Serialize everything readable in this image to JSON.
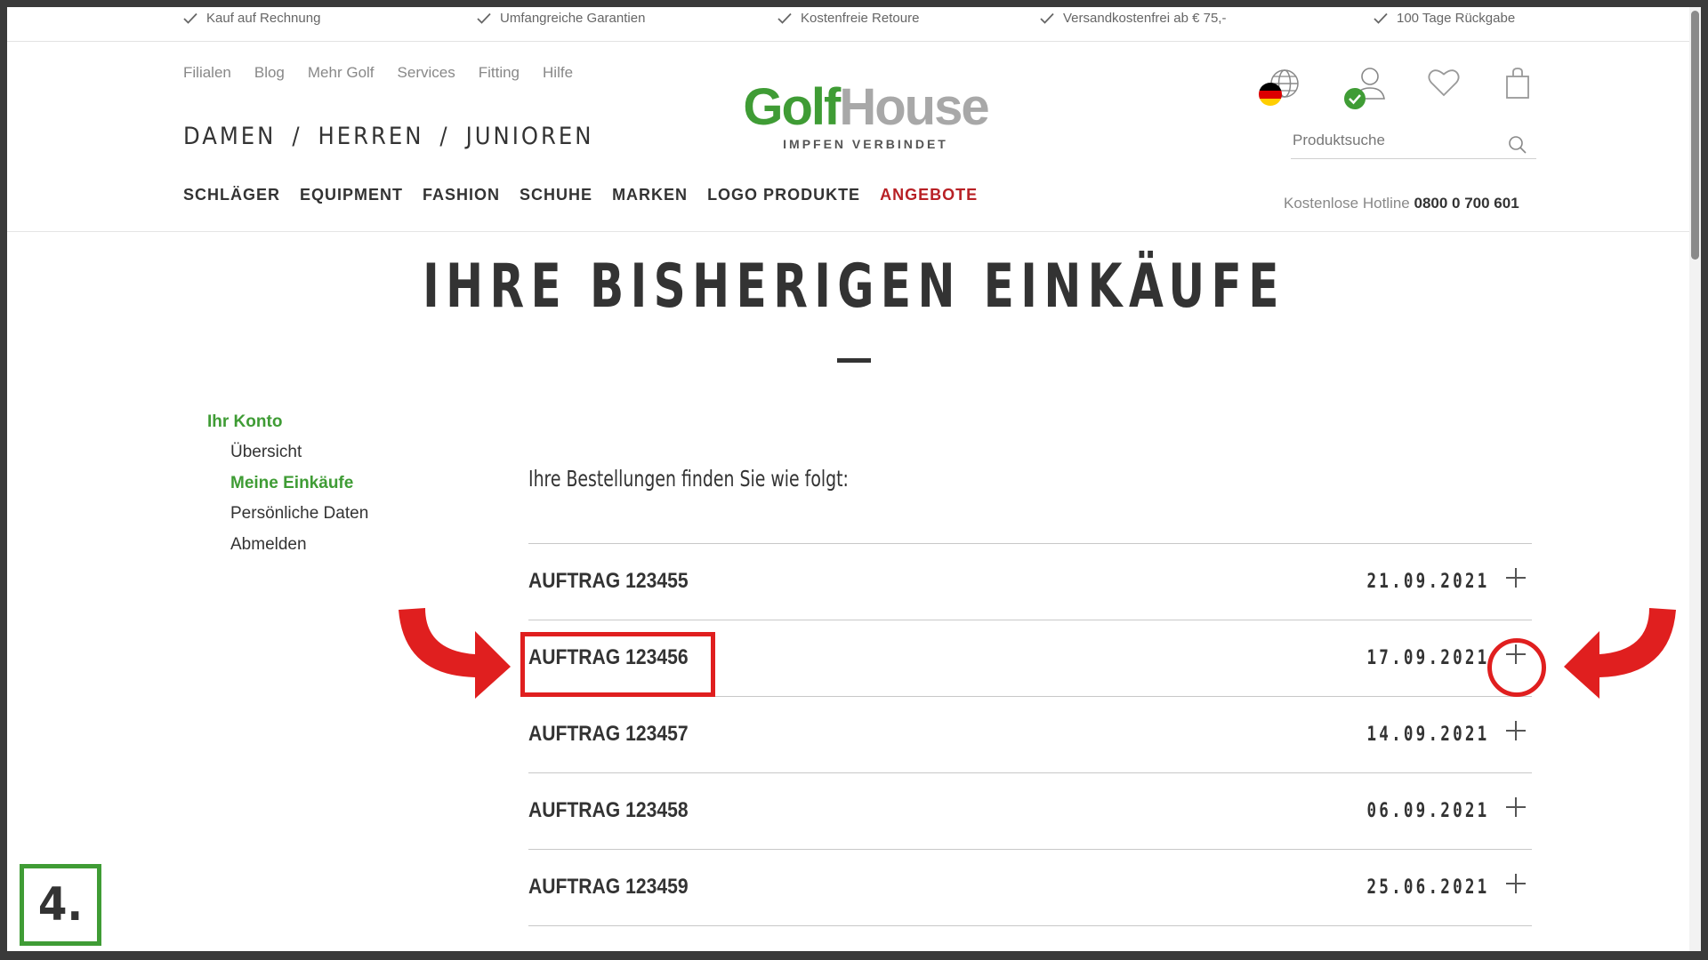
{
  "usp_bar": {
    "items": [
      "Kauf auf Rechnung",
      "Umfangreiche Garantien",
      "Kostenfreie Retoure",
      "Versandkostenfrei ab € 75,-",
      "100 Tage Rückgabe"
    ]
  },
  "meta_nav": [
    "Filialen",
    "Blog",
    "Mehr Golf",
    "Services",
    "Fitting",
    "Hilfe"
  ],
  "gender_nav": [
    "DAMEN",
    "HERREN",
    "JUNIOREN"
  ],
  "gender_separator": "/",
  "main_nav": [
    "SCHLÄGER",
    "EQUIPMENT",
    "FASHION",
    "SCHUHE",
    "MARKEN",
    "LOGO PRODUKTE",
    "ANGEBOTE"
  ],
  "logo": {
    "part1": "Golf",
    "part2": "House",
    "tagline": "IMPFEN VERBINDET"
  },
  "search": {
    "placeholder": "Produktsuche"
  },
  "hotline": {
    "label": "Kostenlose Hotline",
    "number": "0800 0 700 601"
  },
  "page": {
    "title": "IHRE BISHERIGEN EINKÄUFE"
  },
  "sidebar": {
    "heading": "Ihr Konto",
    "items": [
      "Übersicht",
      "Meine Einkäufe",
      "Persönliche Daten",
      "Abmelden"
    ],
    "active": "Meine Einkäufe"
  },
  "orders": {
    "intro": "Ihre Bestellungen finden Sie wie folgt:",
    "rows": [
      {
        "name": "AUFTRAG 123455",
        "date": "21.09.2021"
      },
      {
        "name": "AUFTRAG 123456",
        "date": "17.09.2021"
      },
      {
        "name": "AUFTRAG 123457",
        "date": "14.09.2021"
      },
      {
        "name": "AUFTRAG 123458",
        "date": "06.09.2021"
      },
      {
        "name": "AUFTRAG 123459",
        "date": "25.06.2021"
      }
    ]
  },
  "annotation": {
    "step_label": "4."
  },
  "colors": {
    "brand_green": "#3f9c35",
    "offer_red": "#b82025",
    "annotation_red": "#e01f1f"
  }
}
